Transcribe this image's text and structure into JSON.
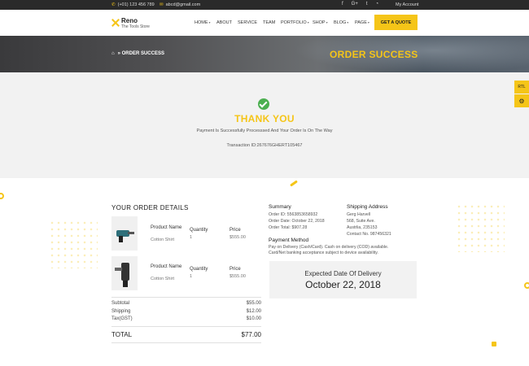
{
  "topbar": {
    "phone": "(+01) 123 456 789",
    "email": "abcd@gmail.com",
    "social": [
      "f",
      "G+",
      "t",
      "rss"
    ],
    "account": "My Account",
    "icons": [
      "phone-icon",
      "email-icon"
    ]
  },
  "logo": {
    "name": "Reno",
    "tagline": "The Tools Store"
  },
  "nav": [
    {
      "label": "HOME",
      "dropdown": true
    },
    {
      "label": "ABOUT",
      "dropdown": false
    },
    {
      "label": "SERVICE",
      "dropdown": false
    },
    {
      "label": "TEAM",
      "dropdown": false
    },
    {
      "label": "PORTFOLIO",
      "dropdown": true
    },
    {
      "label": "SHOP",
      "dropdown": true
    },
    {
      "label": "BLOG",
      "dropdown": true
    },
    {
      "label": "PAGE",
      "dropdown": true
    }
  ],
  "quote_button": "GET A QUOTE",
  "hero": {
    "breadcrumb": "ORDER SUCCESS",
    "title": "ORDER SUCCESS"
  },
  "thanks": {
    "title": "THANK YOU",
    "message": "Payment Is Successfully Processsed And Your Order Is On The Way",
    "transaction": "Transaction ID:267676GHERT105467"
  },
  "side": {
    "rtl": "RTL",
    "settings_icon": "gear-icon"
  },
  "order": {
    "title": "YOUR ORDER DETAILS",
    "products": [
      {
        "name_label": "Product Name",
        "name": "Cotton Shirt",
        "qty_label": "Quantity",
        "qty": "1",
        "price_label": "Price",
        "price": "$555.00"
      },
      {
        "name_label": "Product Name",
        "name": "Cotton Shirt",
        "qty_label": "Quantity",
        "qty": "1",
        "price_label": "Price",
        "price": "$555.00"
      }
    ],
    "subtotal_label": "Subtotal",
    "subtotal": "$55.00",
    "shipping_label": "Shipping",
    "shipping": "$12.00",
    "tax_label": "Tax(GST)",
    "tax": "$10.00",
    "total_label": "TOTAL",
    "total": "$77.00"
  },
  "summary": {
    "title": "Summary",
    "lines": [
      "Order ID: 5563853658932",
      "Order Date: October 22, 2018",
      "Order Total: $907.28"
    ]
  },
  "shipping_address": {
    "title": "Shipping Address",
    "lines": [
      "Gerg Harvell",
      "568, Suite Ave.",
      "Austrlia, 235153",
      "Contact No. 987456321"
    ]
  },
  "payment": {
    "title": "Payment Method",
    "lines": [
      "Pay on Delivery (Cash/Card). Cash on delivery (COD) available.",
      "Card/Net banking acceptance subject to device availability."
    ]
  },
  "delivery": {
    "label": "Expected Date Of Delivery",
    "date": "October 22, 2018"
  },
  "colors": {
    "accent": "#f5c518",
    "success": "#4caf50",
    "topbar": "#2a2a2a"
  }
}
